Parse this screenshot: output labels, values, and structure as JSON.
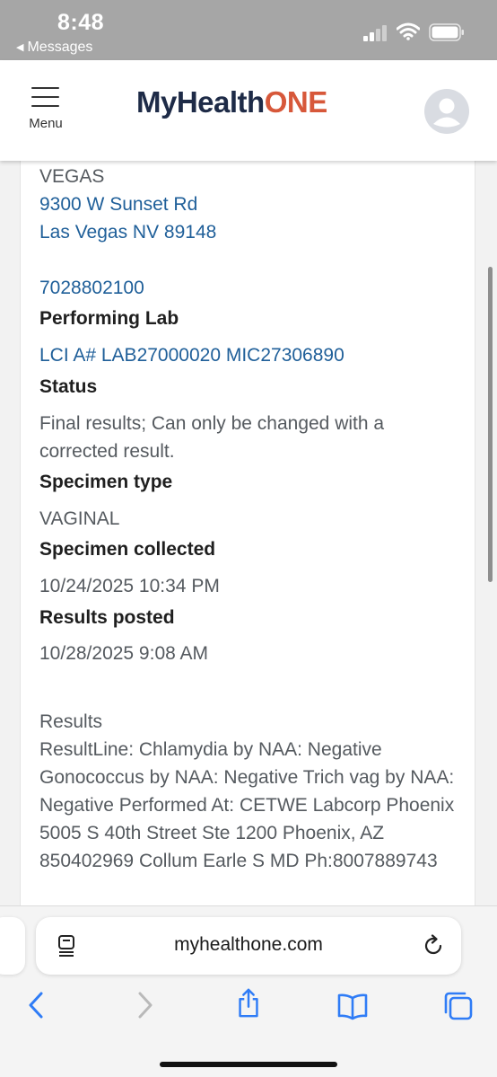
{
  "status_bar": {
    "time": "8:48",
    "back_label": "Messages",
    "back_glyph": "◀"
  },
  "header": {
    "menu_label": "Menu",
    "logo_part1": "MyHealth",
    "logo_part2": "ONE"
  },
  "colors": {
    "brand_navy": "#1e2b47",
    "brand_orange": "#d7583a",
    "link_blue": "#1f5f99"
  },
  "content": {
    "location_city": "VEGAS",
    "address_line1": "9300 W Sunset Rd",
    "address_line2": "Las Vegas NV 89148",
    "phone": "7028802100",
    "performing_lab_label": "Performing Lab",
    "performing_lab_value": "LCI A# LAB27000020 MIC27306890",
    "status_label": "Status",
    "status_value": "Final results; Can only be changed with a corrected result.",
    "specimen_type_label": "Specimen type",
    "specimen_type_value": "VAGINAL",
    "specimen_collected_label": "Specimen collected",
    "specimen_collected_value": "10/24/2025 10:34 PM",
    "results_posted_label": "Results posted",
    "results_posted_value": "10/28/2025 9:08 AM",
    "results_heading": "Results",
    "results_text": "ResultLine: Chlamydia by NAA: Negative Gonococcus by NAA: Negative Trich vag by NAA: Negative Performed At: CETWE Labcorp Phoenix 5005 S 40th Street Ste 1200 Phoenix, AZ 850402969 Collum Earle S MD Ph:8007889743"
  },
  "browser": {
    "url": "myhealthone.com",
    "icons": [
      "page-menu-icon",
      "reload-icon",
      "back-arrow-icon",
      "forward-arrow-icon",
      "share-icon",
      "bookmarks-icon",
      "tabs-icon"
    ]
  }
}
